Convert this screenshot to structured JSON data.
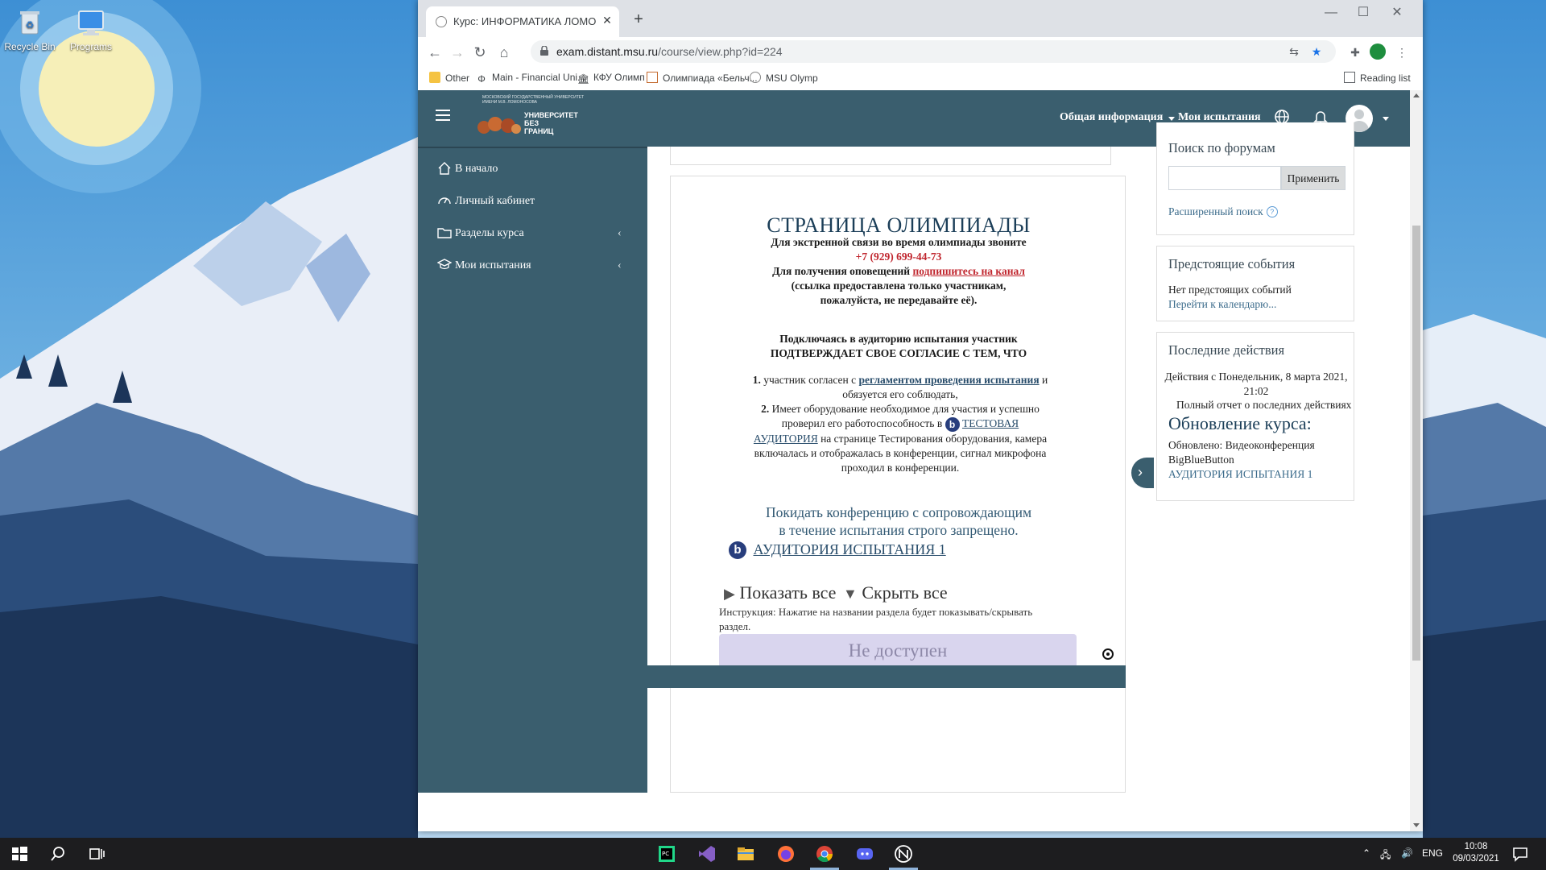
{
  "desktop": {
    "icons": [
      {
        "label": "Recycle Bin"
      },
      {
        "label": "Programs"
      }
    ]
  },
  "browser": {
    "tab_title": "Курс: ИНФОРМАТИКА ЛОМОНО",
    "url_host": "exam.distant.msu.ru",
    "url_path": "/course/view.php?id=224",
    "bookmarks": [
      "Other",
      "Main - Financial Uni...",
      "КФУ Олимп",
      "Олимпиада «Бельч...",
      "MSU Olymp"
    ],
    "reading_list": "Reading list"
  },
  "site": {
    "logo_line": "МОСКОВСКИЙ ГОСУДАРСТВЕННЫЙ УНИВЕРСИТЕТ ИМЕНИ М.В. ЛОМОНОСОВА",
    "logo_name_1": "УНИВЕРСИТЕТ",
    "logo_name_2": "БЕЗ",
    "logo_name_3": "ГРАНИЦ",
    "nav_general": "Общая информация",
    "nav_my_tests": "Мои испытания"
  },
  "drawer": {
    "items": [
      {
        "label": "В начало",
        "icon": "home-icon"
      },
      {
        "label": "Личный кабинет",
        "icon": "dashboard-icon"
      },
      {
        "label": "Разделы курса",
        "icon": "folder-icon"
      },
      {
        "label": "Мои испытания",
        "icon": "graduation-cap-icon"
      }
    ]
  },
  "course": {
    "title": "СТРАНИЦА ОЛИМПИАДЫ",
    "emergency": "Для экстренной связи во время олимпиады звоните",
    "phone": "+7 (929) 699-44-73",
    "notify_prefix": "Для получения оповещений",
    "notify_link": "подпишитесь на канал",
    "notify_note_1": "(ссылка предоставлена только участникам,",
    "notify_note_2": "пожалуйста, не передавайте её).",
    "consent_1": "Подключаясь в аудиторию испытания участник",
    "consent_2": "ПОДТВЕРЖДАЕТ СВОЕ СОГЛАСИЕ С ТЕМ, ЧТО",
    "item1_num": "1.",
    "item1_pre": "участник согласен с",
    "item1_link": "регламентом проведения испытания",
    "item1_post": "и обязуется его соблюдать,",
    "item2_num": "2.",
    "item2_pre": "Имеет оборудование необходимое для участия и успешно проверил его работоспособность в",
    "item2_link": "ТЕСТОВАЯ АУДИТОРИЯ",
    "item2_post": "на странице Тестирования оборудования, камера включалась и отображалась в конференции, сигнал микрофона проходил в конференции.",
    "warning_1": "Покидать конференцию с сопровождающим",
    "warning_2": "в течение испытания строго запрещено.",
    "conference_link": "АУДИТОРИЯ ИСПЫТАНИЯ 1",
    "show_all": "Показать все",
    "hide_all": "Скрыть все",
    "instruction": "Инструкция: Нажатие на названии раздела будет показывать/скрывать раздел.",
    "not_available": "Не доступен"
  },
  "blocks": {
    "forum_search_title": "Поиск по форумам",
    "apply": "Применить",
    "advanced_search": "Расширенный поиск",
    "upcoming_title": "Предстоящие события",
    "no_events": "Нет предстоящих событий",
    "go_calendar": "Перейти к календарю...",
    "recent_title": "Последние действия",
    "recent_since_1": "Действия с Понедельник, 8 марта 2021,",
    "recent_since_2": "21:02",
    "full_report": "Полный отчет о последних действиях",
    "updates_title": "Обновление курса:",
    "updated_1": "Обновлено: Видеоконференция",
    "updated_2": "BigBlueButton",
    "updated_3": "АУДИТОРИЯ ИСПЫТАНИЯ 1"
  },
  "taskbar": {
    "lang": "ENG",
    "time": "10:08",
    "date": "09/03/2021"
  },
  "colors": {
    "navbar": "#3a5e6e",
    "accent_red": "#c0262e",
    "link": "#2a4e6c"
  }
}
